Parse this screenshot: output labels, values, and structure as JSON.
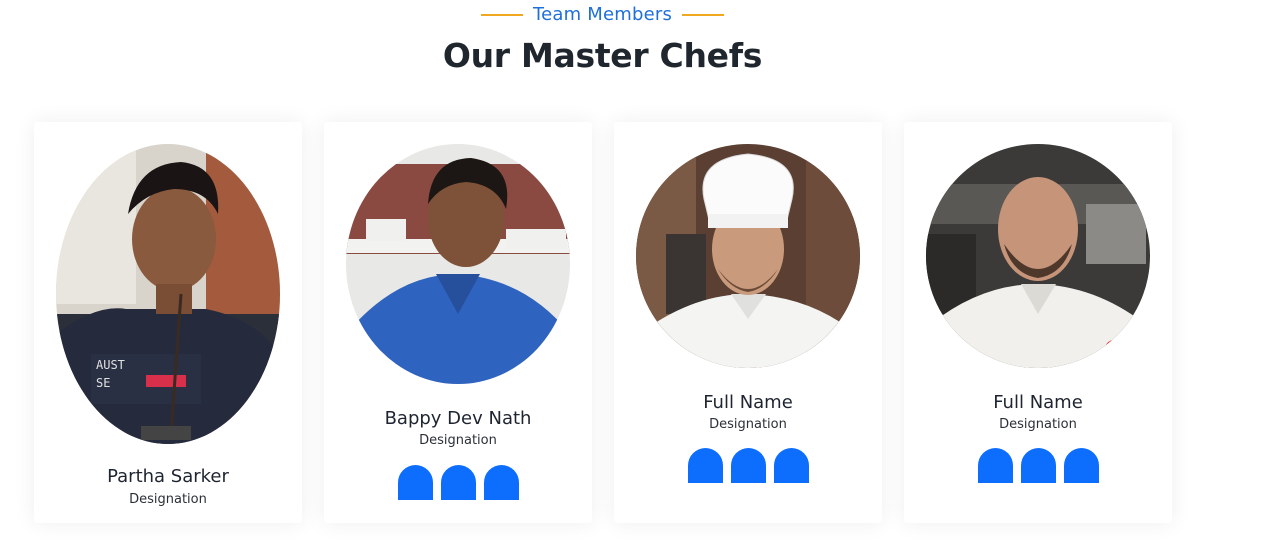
{
  "header": {
    "subtitle": "Team Members",
    "title": "Our Master Chefs"
  },
  "members": [
    {
      "name": "Partha Sarker",
      "designation": "Designation"
    },
    {
      "name": "Bappy Dev Nath",
      "designation": "Designation"
    },
    {
      "name": "Full Name",
      "designation": "Designation"
    },
    {
      "name": "Full Name",
      "designation": "Designation"
    }
  ],
  "colors": {
    "accent_line": "#f0a820",
    "subtitle": "#1e6fd9",
    "social_button": "#0d6efd"
  },
  "icons": [
    "social-icon",
    "social-icon",
    "social-icon"
  ]
}
